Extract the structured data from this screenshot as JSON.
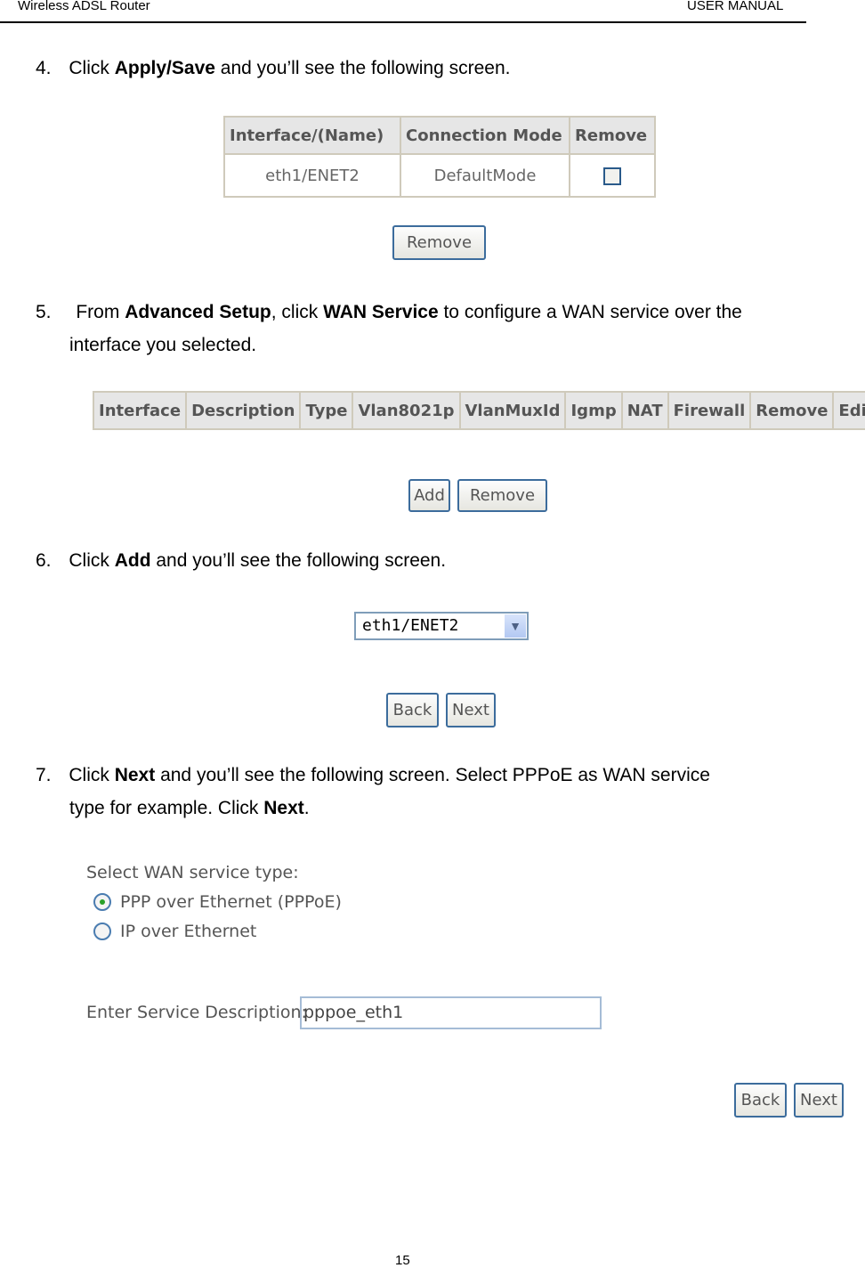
{
  "header": {
    "left": "Wireless ADSL Router",
    "right": "USER MANUAL"
  },
  "step4": {
    "num": "4.",
    "pre": "Click ",
    "bold1": "Apply",
    "sep": "/",
    "bold2": "Save",
    "post": " and you’ll see the following screen."
  },
  "table1": {
    "headers": [
      "Interface/(Name)",
      "Connection Mode",
      "Remove"
    ],
    "row": [
      "eth1/ENET2",
      "DefaultMode"
    ],
    "remove_checked": false,
    "button": "Remove"
  },
  "step5": {
    "num": "5.",
    "pre": "From ",
    "bold1": "Advanced Setup",
    "mid": ", click ",
    "bold2": "WAN Service",
    "post": " to configure a WAN service over the",
    "line2": "interface you selected."
  },
  "table2": {
    "headers": [
      "Interface",
      "Description",
      "Type",
      "Vlan8021p",
      "VlanMuxId",
      "Igmp",
      "NAT",
      "Firewall",
      "Remove",
      "Edit"
    ],
    "add": "Add",
    "remove": "Remove"
  },
  "step6": {
    "num": "6.",
    "pre": "Click ",
    "bold": "Add",
    "post": " and you’ll see the following screen."
  },
  "select": {
    "value": "eth1/ENET2",
    "back": "Back",
    "next": "Next"
  },
  "step7": {
    "num": "7.",
    "pre": "Click ",
    "bold": "Next",
    "post": " and you’ll see the following screen. Select PPPoE as WAN service",
    "line2pre": "type for example. Click ",
    "line2bold": "Next",
    "line2post": "."
  },
  "wan": {
    "label": "Select WAN service type:",
    "options": [
      "PPP over Ethernet (PPPoE)",
      "IP over Ethernet"
    ],
    "selected": 0,
    "desc_label": "Enter Service Description:",
    "desc_value": "pppoe_eth1",
    "back": "Back",
    "next": "Next"
  },
  "footer": {
    "page": "15"
  }
}
